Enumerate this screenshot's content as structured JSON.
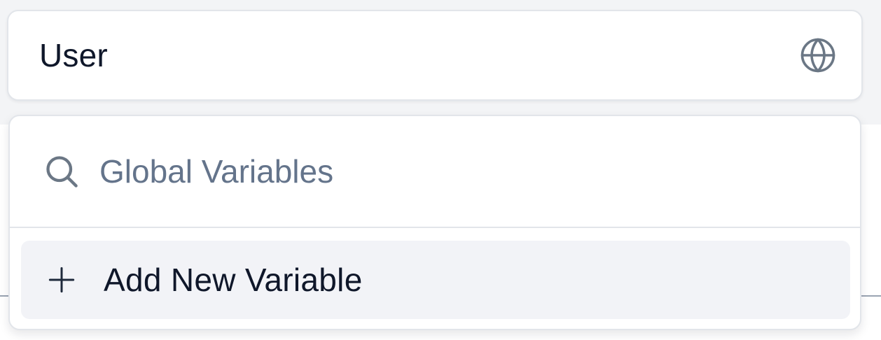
{
  "variable_field": {
    "value": "User",
    "scope_icon": "globe-icon"
  },
  "dropdown": {
    "search": {
      "placeholder": "Global Variables",
      "icon": "search-icon"
    },
    "add_item": {
      "label": "Add New Variable",
      "icon": "plus-icon"
    }
  },
  "colors": {
    "text_primary": "#0f172a",
    "text_muted": "#64748b",
    "icon": "#6b7785",
    "border": "#e2e5ea",
    "item_highlight": "#f2f3f7"
  }
}
